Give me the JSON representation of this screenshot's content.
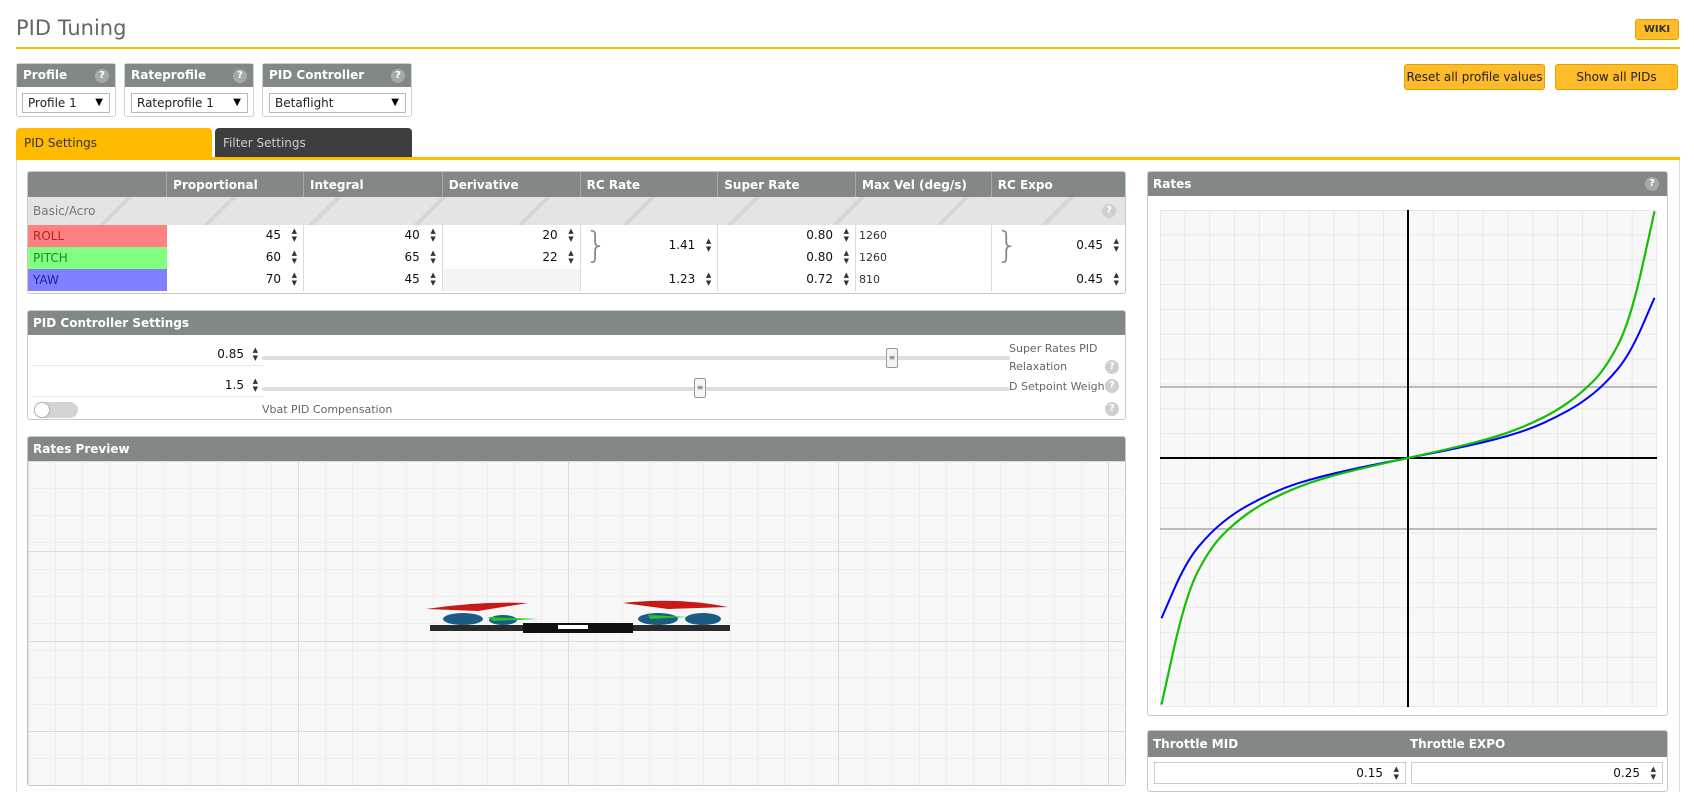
{
  "header": {
    "title": "PID Tuning",
    "wiki_label": "WIKI"
  },
  "selectors": {
    "profile": {
      "label": "Profile",
      "value": "Profile 1"
    },
    "rateprofile": {
      "label": "Rateprofile",
      "value": "Rateprofile 1"
    },
    "pid_controller": {
      "label": "PID Controller",
      "value": "Betaflight"
    }
  },
  "actions": {
    "reset_label": "Reset all profile values",
    "show_pids_label": "Show all PIDs"
  },
  "tabs": [
    {
      "label": "PID Settings",
      "active": true
    },
    {
      "label": "Filter Settings",
      "active": false
    }
  ],
  "pid_table": {
    "columns": [
      "",
      "Proportional",
      "Integral",
      "Derivative",
      "RC Rate",
      "Super Rate",
      "Max Vel (deg/s)",
      "RC Expo"
    ],
    "group_label": "Basic/Acro",
    "rows": [
      {
        "label": "ROLL",
        "color": "#ff8080",
        "p": "45",
        "i": "40",
        "d": "20",
        "rc_rate": "1.41",
        "super_rate": "0.80",
        "max_vel": "1260",
        "rc_expo": "0.45"
      },
      {
        "label": "PITCH",
        "color": "#80ff80",
        "p": "60",
        "i": "65",
        "d": "22",
        "rc_rate": "",
        "super_rate": "0.80",
        "max_vel": "1260",
        "rc_expo": ""
      },
      {
        "label": "YAW",
        "color": "#8080ff",
        "p": "70",
        "i": "45",
        "d": "",
        "rc_rate": "1.23",
        "super_rate": "0.72",
        "max_vel": "810",
        "rc_expo": "0.45"
      }
    ]
  },
  "controller_settings": {
    "title": "PID Controller Settings",
    "relaxation": {
      "value": "0.85",
      "label": "Super Rates PID Relaxation",
      "level": 0.85
    },
    "setpoint": {
      "value": "1.5",
      "label": "D Setpoint Weight",
      "level": 0.58
    },
    "vbat_label": "Vbat PID Compensation",
    "vbat_enabled": false
  },
  "rates_preview": {
    "title": "Rates Preview"
  },
  "rates_chart": {
    "title": "Rates",
    "series_colors": {
      "roll": "#ff0000",
      "pitch": "#00cc00",
      "yaw": "#0000ff"
    }
  },
  "throttle": {
    "mid_label": "Throttle MID",
    "mid_value": "0.15",
    "expo_label": "Throttle EXPO",
    "expo_value": "0.25"
  },
  "chart_data": {
    "type": "line",
    "title": "Rates",
    "xlabel": "",
    "ylabel": "",
    "x": [
      -1.0,
      -0.9,
      -0.8,
      -0.7,
      -0.6,
      -0.5,
      -0.4,
      -0.3,
      -0.2,
      -0.1,
      0.0,
      0.1,
      0.2,
      0.3,
      0.4,
      0.5,
      0.6,
      0.7,
      0.8,
      0.9,
      1.0
    ],
    "series": [
      {
        "values": [
          -1.0,
          -0.55,
          -0.36,
          -0.26,
          -0.19,
          -0.14,
          -0.1,
          -0.07,
          -0.045,
          -0.022,
          0.0,
          0.022,
          0.045,
          0.07,
          0.1,
          0.14,
          0.19,
          0.26,
          0.36,
          0.55,
          1.0
        ]
      },
      {
        "values": [
          -1.0,
          -0.55,
          -0.36,
          -0.26,
          -0.19,
          -0.14,
          -0.1,
          -0.07,
          -0.045,
          -0.022,
          0.0,
          0.022,
          0.045,
          0.07,
          0.1,
          0.14,
          0.19,
          0.26,
          0.36,
          0.55,
          1.0
        ]
      },
      {
        "values": [
          -0.65,
          -0.42,
          -0.3,
          -0.22,
          -0.165,
          -0.12,
          -0.088,
          -0.062,
          -0.04,
          -0.02,
          0.0,
          0.02,
          0.04,
          0.062,
          0.088,
          0.12,
          0.165,
          0.22,
          0.3,
          0.42,
          0.65
        ]
      }
    ]
  }
}
